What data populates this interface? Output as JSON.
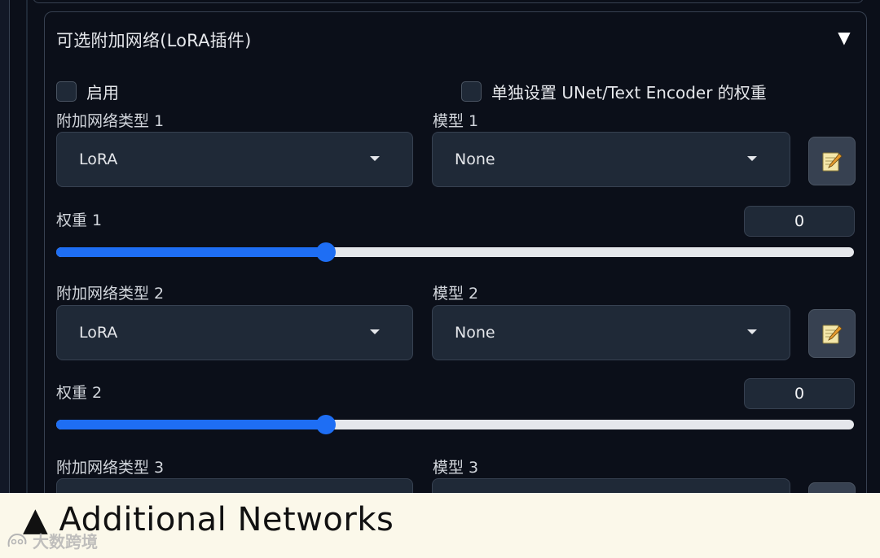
{
  "panel": {
    "title": "可选附加网络(LoRA插件)",
    "collapse_icon": "▼"
  },
  "options": {
    "enable_label": "启用",
    "separate_weights_label": "单独设置 UNet/Text Encoder 的权重"
  },
  "slots": [
    {
      "network_type_label": "附加网络类型 1",
      "network_type_value": "LoRA",
      "model_label": "模型 1",
      "model_value": "None",
      "weight_label": "权重 1",
      "weight_value": "0",
      "weight_fraction": 0.338
    },
    {
      "network_type_label": "附加网络类型 2",
      "network_type_value": "LoRA",
      "model_label": "模型 2",
      "model_value": "None",
      "weight_label": "权重 2",
      "weight_value": "0",
      "weight_fraction": 0.338
    },
    {
      "network_type_label": "附加网络类型 3",
      "model_label": "模型 3"
    }
  ],
  "caption": {
    "text": "▲ Additional Networks",
    "watermark": "大数跨境"
  },
  "colors": {
    "background": "#0b0f19",
    "accent": "#1e6ef4",
    "caption_bg": "#fbf8ea"
  }
}
